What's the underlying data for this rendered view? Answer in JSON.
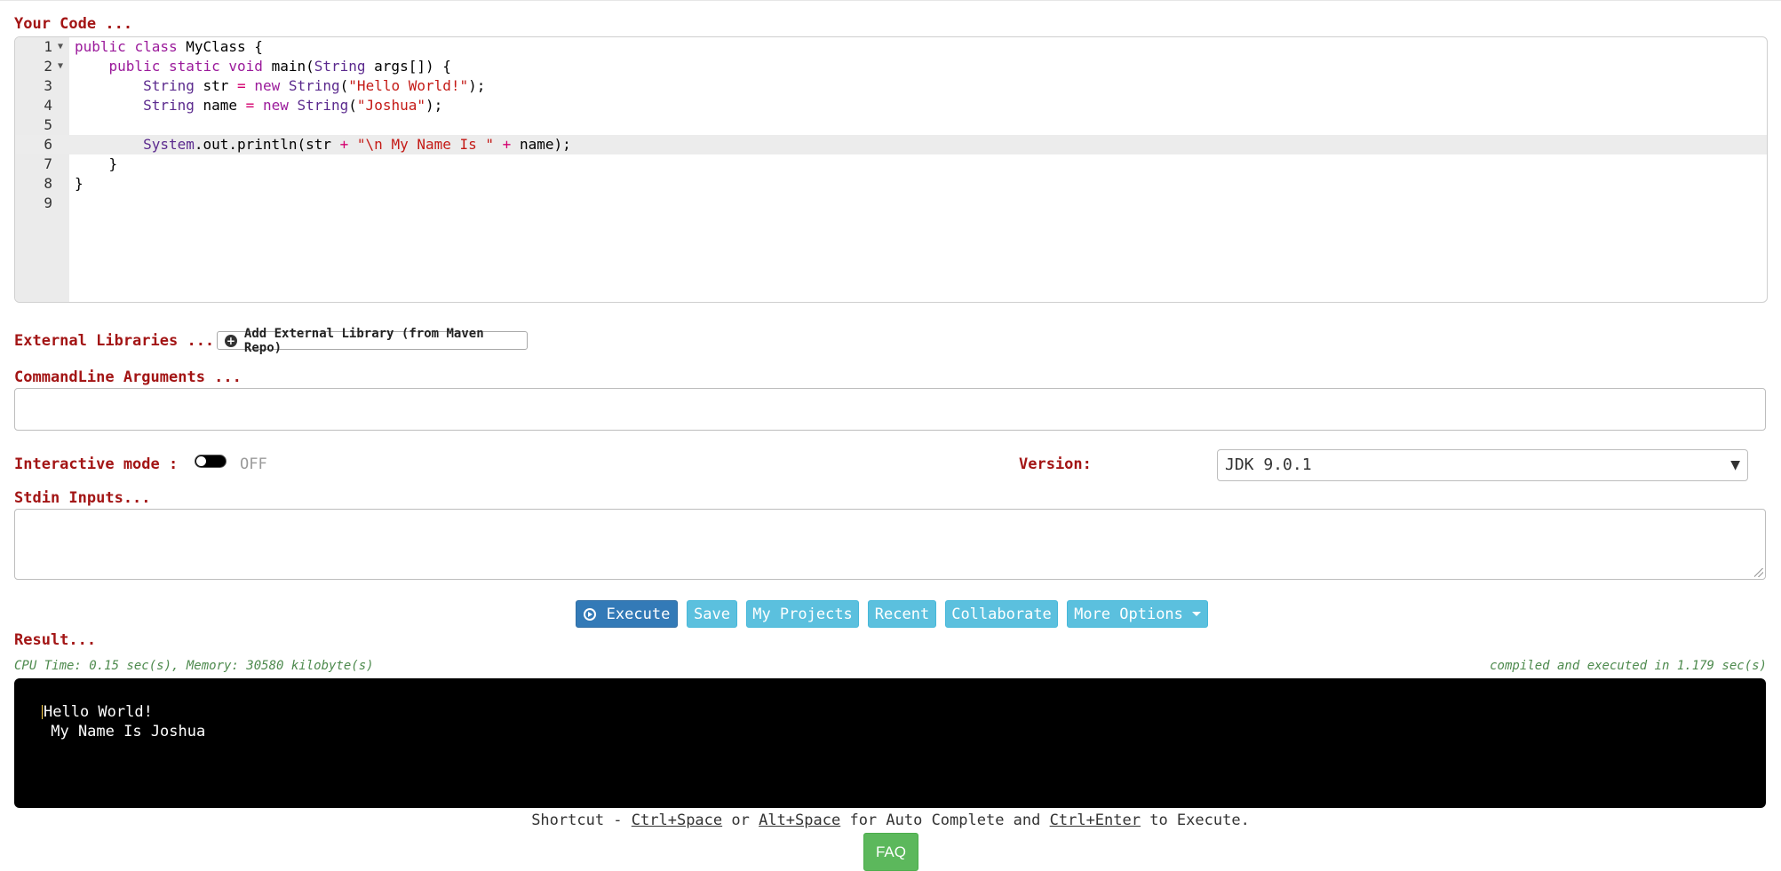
{
  "labels": {
    "your_code": "Your Code ...",
    "external_libraries": "External Libraries ...",
    "commandline_arguments": "CommandLine Arguments ...",
    "interactive_mode": "Interactive mode :",
    "version": "Version:",
    "stdin_inputs": "Stdin Inputs...",
    "result": "Result..."
  },
  "editor": {
    "active_line": 6,
    "lines": [
      {
        "num": "1",
        "fold": true
      },
      {
        "num": "2",
        "fold": true
      },
      {
        "num": "3",
        "fold": false
      },
      {
        "num": "4",
        "fold": false
      },
      {
        "num": "5",
        "fold": false
      },
      {
        "num": "6",
        "fold": false
      },
      {
        "num": "7",
        "fold": false
      },
      {
        "num": "8",
        "fold": false
      },
      {
        "num": "9",
        "fold": false
      }
    ]
  },
  "external_library_button": "Add External Library (from Maven Repo)",
  "commandline_input": {
    "value": "",
    "placeholder": ""
  },
  "interactive_mode_state": "OFF",
  "version_select": {
    "selected": "JDK 9.0.1"
  },
  "stdin_input": {
    "value": ""
  },
  "toolbar": {
    "execute": "Execute",
    "save": "Save",
    "my_projects": "My Projects",
    "recent": "Recent",
    "collaborate": "Collaborate",
    "more_options": "More Options"
  },
  "result": {
    "cpu_info": "CPU Time: 0.15 sec(s), Memory: 30580 kilobyte(s)",
    "compile_info": "compiled and executed in 1.179 sec(s)",
    "output_line1": "Hello World!",
    "output_line2": " My Name Is Joshua"
  },
  "shortcut": {
    "prefix": "Shortcut - ",
    "key1": "Ctrl+Space",
    "or": " or ",
    "key2": "Alt+Space",
    "mid": " for Auto Complete and ",
    "key3": "Ctrl+Enter",
    "suffix": " to Execute."
  },
  "faq_button": "FAQ",
  "colors": {
    "label_red": "#a31515",
    "execute_blue": "#337ab7",
    "info_cyan": "#5bc0de",
    "faq_green": "#5cb85c",
    "meta_green": "#4d8a4d",
    "terminal_bg": "#000000"
  },
  "icons": [
    "fold-arrow-icon",
    "plus-circle-icon",
    "play-circle-icon",
    "dropdown-caret-icon",
    "select-arrow-icon",
    "resize-grip-icon"
  ]
}
